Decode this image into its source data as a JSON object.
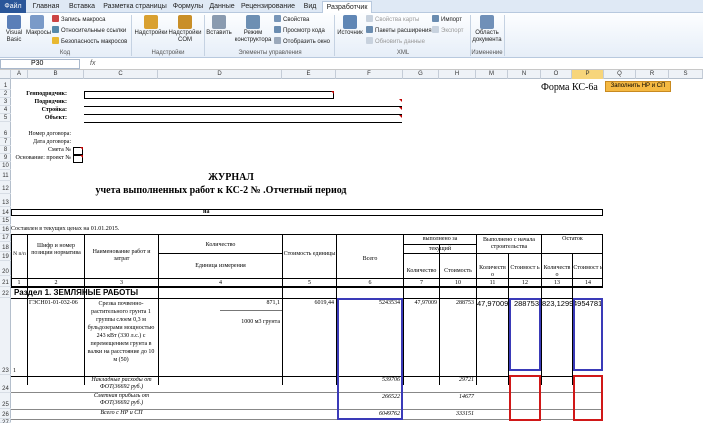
{
  "tabs": [
    "Файл",
    "Главная",
    "Вставка",
    "Разметка страницы",
    "Формулы",
    "Данные",
    "Рецензирование",
    "Вид",
    "Разработчик"
  ],
  "active_tab": "Разработчик",
  "ribbon": {
    "visual_basic": "Visual Basic",
    "macros": "Макросы",
    "record_macro": "Запись макроса",
    "relative_refs": "Относительные ссылки",
    "macro_security": "Безопасность макросов",
    "group_code": "Код",
    "addins": "Надстройки",
    "com_addins": "Надстройки COM",
    "group_addins": "Надстройки",
    "insert": "Вставить",
    "design_mode": "Режим конструктора",
    "properties": "Свойства",
    "view_code": "Просмотр кода",
    "run_dialog": "Отобразить окно",
    "group_controls": "Элементы управления",
    "source": "Источник",
    "map_props": "Свойства карты",
    "expansion_packs": "Пакеты расширения",
    "refresh_data": "Обновить данные",
    "import": "Импорт",
    "export": "Экспорт",
    "group_xml": "XML",
    "doc_panel": "Область документа",
    "group_modify": "Изменение"
  },
  "formula_bar": {
    "name_box": "P30",
    "fx": "fx",
    "formula": ""
  },
  "columns": [
    "A",
    "B",
    "C",
    "D",
    "E",
    "F",
    "G",
    "H",
    "M",
    "N",
    "O",
    "P",
    "Q",
    "R",
    "S"
  ],
  "selected_column": "P",
  "rows": [
    "1",
    "2",
    "3",
    "4",
    "5",
    "6",
    "7",
    "8",
    "9",
    "10",
    "11",
    "12",
    "13",
    "14",
    "15",
    "16",
    "17",
    "18",
    "19",
    "20",
    "21",
    "22",
    "23",
    "24",
    "25",
    "26",
    "27"
  ],
  "sheet": {
    "form_title": "Форма КС-6а",
    "fill_button": "Заполнить НР и СП",
    "labels": {
      "general_contractor": "Генподрядчик:",
      "subcontractor": "Подрядчик:",
      "construction": "Стройка:",
      "object": "Объект:",
      "contract_no": "Номер договора:",
      "contract_date": "Дата договора:",
      "estimate_no": "Смета №",
      "basis": "Основание: проект №"
    },
    "journal_title": "ЖУРНАЛ",
    "journal_subtitle": "учета выполненных работ  к КС-2 №  .Отчетный период",
    "na": "на",
    "prices_note": "Составлен в текущих ценах на 01.01.2015.",
    "headers": {
      "num": "N п/п",
      "code": "Шифр и номер позиции норматива",
      "name": "Наименование работ и затрат",
      "quantity": "Количество",
      "unit": "Единица измерения",
      "unit_cost": "Стоимость единицы",
      "total": "Всего",
      "done_for": "выполнено за",
      "current": "текущий",
      "done_since": "Выполнено с начала строительства",
      "remainder": "Остаток",
      "qty": "Количество",
      "cost": "Стоимость",
      "qty_short": "Количеств о",
      "cost_short": "Стоимост ь"
    },
    "col_numbers": [
      "1",
      "2",
      "3",
      "4",
      "5",
      "6",
      "7",
      "10",
      "11",
      "12",
      "13",
      "14",
      "15"
    ],
    "section": "Раздел 1.  ЗЕМЛЯНЫЕ РАБОТЫ",
    "item": {
      "num": "1",
      "code": "ГЭСН01-01-032-06",
      "description": "Срезка почвенно-растительного грунта 1 группы слоем 0,3 м бульдозерами мощностью 243 кВт (330 л.с.) с перемещением грунта в валки на расстояние до 10 м (50)",
      "quantity": "871,1",
      "unit": "1000 м3 грунта",
      "unit_cost": "6019,44",
      "total": "5243534",
      "qty_current": "47,97009",
      "cost_current": "288753",
      "qty_since": "47,97009",
      "cost_since": "288753",
      "qty_rem": "823,1299",
      "cost_rem": "4954781"
    },
    "overhead": {
      "label": "Накладные расходы от ФОТ(36692 руб.)",
      "total": "539706",
      "current": "29721"
    },
    "profit": {
      "label": "Сметная прибыль от ФОТ(36692 руб.)",
      "total": "266522",
      "current": "14677"
    },
    "with_overhead": {
      "label": "Всего с НР и СП",
      "total": "6049762",
      "current": "333151"
    }
  }
}
